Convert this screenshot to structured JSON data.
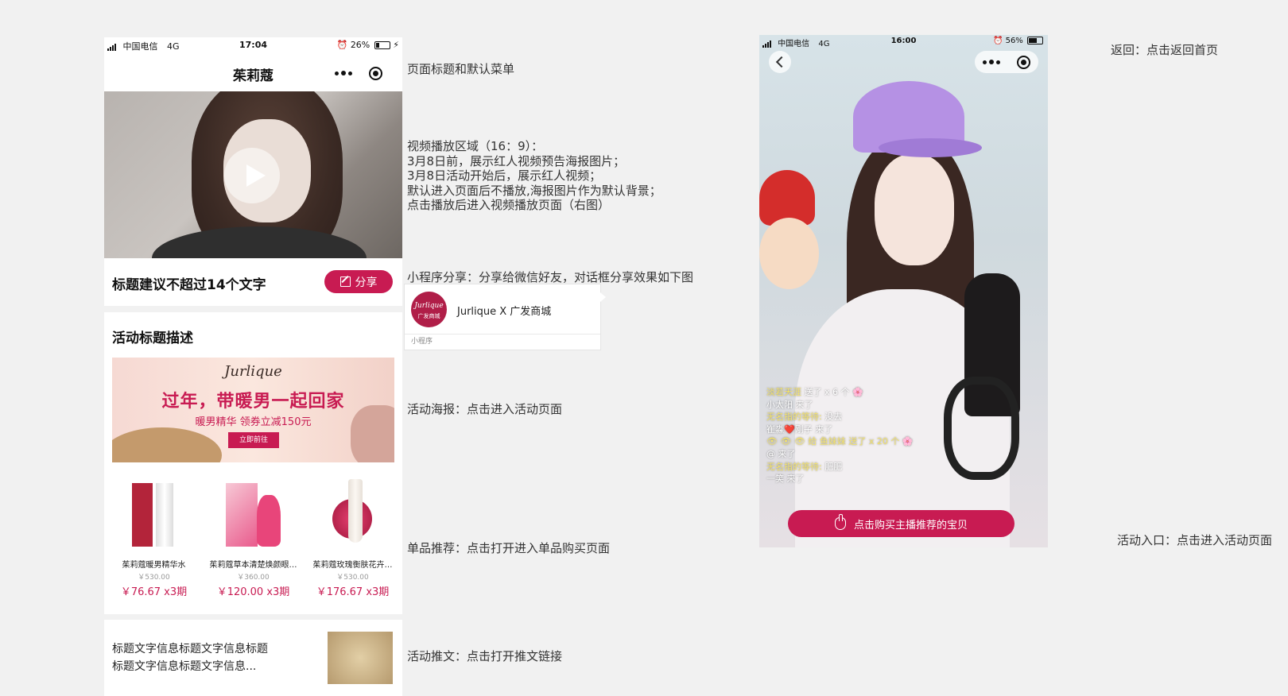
{
  "left_phone": {
    "status": {
      "carrier": "中国电信",
      "network": "4G",
      "time": "17:04",
      "battery": "26%"
    },
    "nav": {
      "title": "茱莉蔻"
    },
    "video": {
      "state": "poster-paused"
    },
    "title_card": {
      "title": "标题建议不超过14个文字",
      "share_label": "分享"
    },
    "activity": {
      "heading": "活动标题描述",
      "banner": {
        "brand": "Jurlique",
        "headline": "过年，带暖男一起回家",
        "sub": "暖男精华 领券立减150元",
        "button": "立即前往"
      },
      "products": [
        {
          "name": "茱莉蔻暖男精华水",
          "orig": "￥530.00",
          "price": "￥76.67 x3期"
        },
        {
          "name": "茱莉蔻草本清楚焕颜眼…",
          "orig": "￥360.00",
          "price": "￥120.00 x3期"
        },
        {
          "name": "茱莉蔻玫瑰衡肤花卉…",
          "orig": "￥530.00",
          "price": "￥176.67 x3期"
        }
      ]
    },
    "article": {
      "line1": "标题文字信息标题文字信息标题",
      "line2": "标题文字信息标题文字信息..."
    }
  },
  "notes": {
    "nav": "页面标题和默认菜单",
    "video_lines": [
      "视频播放区域（16：9）：",
      "3月8日前，展示红人视频预告海报图片；",
      "3月8日活动开始后，展示红人视频；",
      "默认进入页面后不播放,海报图片作为默认背景；",
      "点击播放后进入视频播放页面（右图）"
    ],
    "share": "小程序分享：分享给微信好友，对话框分享效果如下图",
    "poster": "活动海报：点击进入活动页面",
    "products": "单品推荐：点击打开进入单品购买页面",
    "article": "活动推文：点击打开推文链接",
    "back": "返回：点击返回首页",
    "entry": "活动入口：点击进入活动页面"
  },
  "share_popup": {
    "logo_line1": "Jurlique",
    "logo_line2": "广发商城",
    "name": "Jurlique X 广发商城",
    "footer": "小程序"
  },
  "right_phone": {
    "status": {
      "carrier": "中国电信",
      "network": "4G",
      "time": "16:00",
      "battery": "56%"
    },
    "comments": [
      {
        "user": "淡若天涯 ",
        "text": "送了 x 6 个 🌸"
      },
      {
        "user": "小太阳",
        "text": " 来了"
      },
      {
        "user": "无名指的等待:",
        "text": " 没去"
      },
      {
        "user": "崔淼❤️刚子",
        "text": " 来了"
      },
      {
        "user": "👁 👁 👁 给 鱼妹妹",
        "text": " 送了 x 20 个 🌸"
      },
      {
        "user": "@",
        "text": " 来了"
      },
      {
        "user": "无名指的等待:",
        "text": " 肥肥"
      },
      {
        "user": "一笑",
        "text": " 来了"
      }
    ],
    "buy_button": "点击购买主播推荐的宝贝"
  },
  "colors": {
    "accent": "#c81b52",
    "bg": "#f1f1f1"
  }
}
